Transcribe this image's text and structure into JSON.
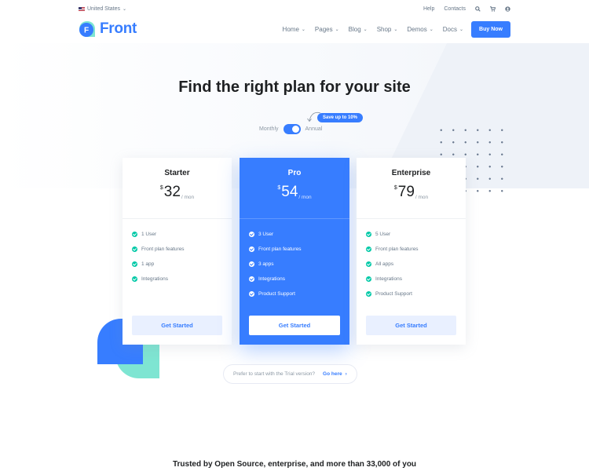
{
  "topbar": {
    "language": "United States",
    "links": [
      "Help",
      "Contacts"
    ],
    "icons": [
      "search-icon",
      "cart-icon",
      "user-icon"
    ]
  },
  "brand": {
    "name": "Front",
    "mark_letter": "F",
    "color": "#377dff"
  },
  "nav": {
    "items": [
      "Home",
      "Pages",
      "Blog",
      "Shop",
      "Demos",
      "Docs"
    ],
    "cta": "Buy Now"
  },
  "hero": {
    "title": "Find the right plan for your site",
    "toggle": {
      "left": "Monthly",
      "right": "Annual",
      "selected": "Annual"
    },
    "badge": "Save up to 10%"
  },
  "plans": [
    {
      "name": "Starter",
      "currency": "$",
      "price": "32",
      "period": "/ mon",
      "features": [
        "1 User",
        "Front plan features",
        "1 app",
        "Integrations"
      ],
      "button": "Get Started"
    },
    {
      "name": "Pro",
      "currency": "$",
      "price": "54",
      "period": "/ mon",
      "features": [
        "3 User",
        "Front plan features",
        "3 apps",
        "Integrations",
        "Product Support"
      ],
      "button": "Get Started"
    },
    {
      "name": "Enterprise",
      "currency": "$",
      "price": "79",
      "period": "/ mon",
      "features": [
        "5 User",
        "Front plan features",
        "All apps",
        "Integrations",
        "Product Support"
      ],
      "button": "Get Started"
    }
  ],
  "trial": {
    "text": "Prefer to start with the Trial version?",
    "link": "Go here"
  },
  "trusted": "Trusted by Open Source, enterprise, and more than 33,000 of you",
  "colors": {
    "primary": "#377dff",
    "success": "#00c9a7",
    "accent_teal": "#7ee5d2"
  }
}
